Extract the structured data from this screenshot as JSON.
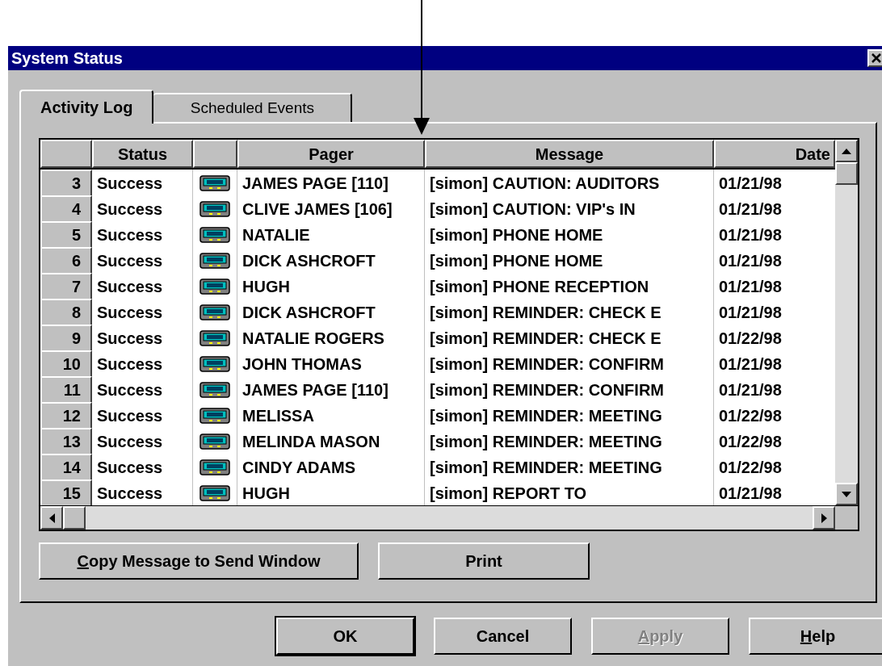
{
  "window": {
    "title": "System Status"
  },
  "tabs": [
    {
      "label": "Activity Log",
      "selected": true
    },
    {
      "label": "Scheduled Events",
      "selected": false
    }
  ],
  "table": {
    "columns": [
      "Status",
      "Pager",
      "Message",
      "Date"
    ],
    "rows": [
      {
        "number": "3",
        "status": "Success",
        "pager": "JAMES PAGE [110]",
        "message": "[simon] CAUTION: AUDITORS",
        "date": "01/21/98"
      },
      {
        "number": "4",
        "status": "Success",
        "pager": "CLIVE JAMES [106]",
        "message": "[simon] CAUTION: VIP's IN",
        "date": "01/21/98"
      },
      {
        "number": "5",
        "status": "Success",
        "pager": "NATALIE",
        "message": "[simon] PHONE HOME",
        "date": "01/21/98"
      },
      {
        "number": "6",
        "status": "Success",
        "pager": "DICK ASHCROFT",
        "message": "[simon] PHONE HOME",
        "date": "01/21/98"
      },
      {
        "number": "7",
        "status": "Success",
        "pager": "HUGH",
        "message": "[simon] PHONE RECEPTION",
        "date": "01/21/98"
      },
      {
        "number": "8",
        "status": "Success",
        "pager": "DICK ASHCROFT",
        "message": "[simon] REMINDER: CHECK E",
        "date": "01/21/98"
      },
      {
        "number": "9",
        "status": "Success",
        "pager": "NATALIE ROGERS",
        "message": "[simon] REMINDER: CHECK E",
        "date": "01/22/98"
      },
      {
        "number": "10",
        "status": "Success",
        "pager": "JOHN THOMAS",
        "message": "[simon] REMINDER: CONFIRM",
        "date": "01/21/98"
      },
      {
        "number": "11",
        "status": "Success",
        "pager": "JAMES PAGE [110]",
        "message": "[simon] REMINDER: CONFIRM",
        "date": "01/21/98"
      },
      {
        "number": "12",
        "status": "Success",
        "pager": "MELISSA",
        "message": "[simon] REMINDER: MEETING",
        "date": "01/22/98"
      },
      {
        "number": "13",
        "status": "Success",
        "pager": "MELINDA MASON",
        "message": "[simon] REMINDER: MEETING",
        "date": "01/22/98"
      },
      {
        "number": "14",
        "status": "Success",
        "pager": "CINDY ADAMS",
        "message": "[simon] REMINDER: MEETING",
        "date": "01/22/98"
      },
      {
        "number": "15",
        "status": "Success",
        "pager": "HUGH",
        "message": "[simon] REPORT TO",
        "date": "01/21/98"
      }
    ]
  },
  "tab_buttons": [
    {
      "label": "Copy Message to Send Window",
      "underline_first": true
    },
    {
      "label": "Print",
      "underline_first": false
    }
  ],
  "dialog_buttons": [
    {
      "label": "OK",
      "underline_first": false,
      "disabled": false,
      "default": true
    },
    {
      "label": "Cancel",
      "underline_first": false,
      "disabled": false,
      "default": false
    },
    {
      "label": "Apply",
      "underline_first": true,
      "disabled": true,
      "default": false
    },
    {
      "label": "Help",
      "underline_first": true,
      "disabled": false,
      "default": false
    }
  ]
}
